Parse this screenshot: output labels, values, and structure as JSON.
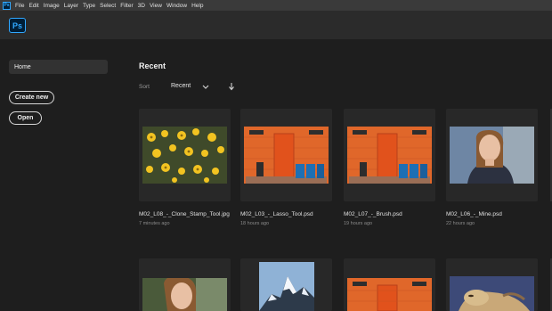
{
  "menubar": {
    "app_badge": "Ps",
    "items": [
      "File",
      "Edit",
      "Image",
      "Layer",
      "Type",
      "Select",
      "Filter",
      "3D",
      "View",
      "Window",
      "Help"
    ]
  },
  "appbar": {
    "logo": "Ps"
  },
  "sidebar": {
    "home_label": "Home",
    "create_new_label": "Create new",
    "open_label": "Open"
  },
  "main": {
    "title": "Recent",
    "sort_label": "Sort",
    "sort_value": "Recent",
    "sort_icons": [
      "chevron-down-icon",
      "sort-descending-arrow-icon"
    ]
  },
  "recent_files": [
    {
      "name": "M02_L08_-_Clone_Stamp_Tool.jpg",
      "time": "7 minutes ago",
      "thumb": "yellow-flowers"
    },
    {
      "name": "M02_L03_-_Lasso_Tool.psd",
      "time": "18 hours ago",
      "thumb": "orange-wall-bins"
    },
    {
      "name": "M02_L07_-_Brush.psd",
      "time": "19 hours ago",
      "thumb": "orange-wall-bins"
    },
    {
      "name": "M02_L06_-_Mine.psd",
      "time": "22 hours ago",
      "thumb": "woman-portrait"
    },
    {
      "name": "",
      "time": "",
      "thumb": "woman-portrait"
    },
    {
      "name": "",
      "time": "",
      "thumb": "snowy-mountain"
    },
    {
      "name": "",
      "time": "",
      "thumb": "orange-wall"
    },
    {
      "name": "",
      "time": "",
      "thumb": "sleeping-dog"
    }
  ],
  "colors": {
    "menubar_bg": "#3a3a3a",
    "appbar_bg": "#2b2b2b",
    "body_bg": "#1e1e1e",
    "card_bg": "#282828",
    "ps_blue": "#31a8ff",
    "ps_dark": "#001e36"
  }
}
